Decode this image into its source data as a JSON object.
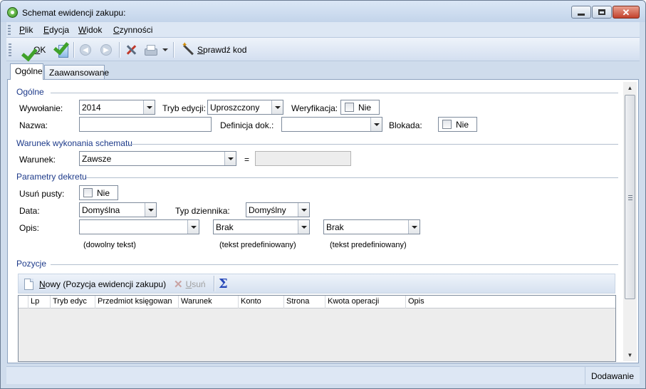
{
  "window": {
    "title": "Schemat ewidencji zakupu:"
  },
  "menu": {
    "items": [
      "Plik",
      "Edycja",
      "Widok",
      "Czynności"
    ]
  },
  "toolbar": {
    "ok_label": "OK",
    "check_code_label": "Sprawdź kod"
  },
  "tabs": [
    "Ogólne",
    "Zaawansowane"
  ],
  "general": {
    "section_title": "Ogólne",
    "wywolanie_label": "Wywołanie:",
    "wywolanie_value": "2014",
    "tryb_label": "Tryb edycji:",
    "tryb_value": "Uproszczony",
    "weryfikacja_label": "Weryfikacja:",
    "weryfikacja_value": "Nie",
    "nazwa_label": "Nazwa:",
    "nazwa_value": "",
    "definicja_label": "Definicja dok.:",
    "definicja_value": "",
    "blokada_label": "Blokada:",
    "blokada_value": "Nie"
  },
  "condition": {
    "section_title": "Warunek wykonania schematu",
    "warunek_label": "Warunek:",
    "warunek_value": "Zawsze",
    "equals": "=",
    "expression_value": ""
  },
  "decree": {
    "section_title": "Parametry dekretu",
    "usun_label": "Usuń pusty:",
    "usun_value": "Nie",
    "data_label": "Data:",
    "data_value": "Domyślna",
    "typ_label": "Typ dziennika:",
    "typ_value": "Domyślny",
    "opis_label": "Opis:",
    "opis_value": "",
    "opis2_value": "Brak",
    "opis3_value": "Brak",
    "hint_free": "(dowolny tekst)",
    "hint_predef": "(tekst predefiniowany)",
    "hint_predef2": "(tekst predefiniowany)"
  },
  "positions": {
    "section_title": "Pozycje",
    "new_label": "Nowy (Pozycja ewidencji zakupu)",
    "delete_label": "Usuń",
    "columns": [
      "Lp",
      "Tryb edyc",
      "Przedmiot księgowan",
      "Warunek",
      "Konto",
      "Strona",
      "Kwota operacji",
      "Opis"
    ]
  },
  "status": {
    "mode": "Dodawanie"
  }
}
